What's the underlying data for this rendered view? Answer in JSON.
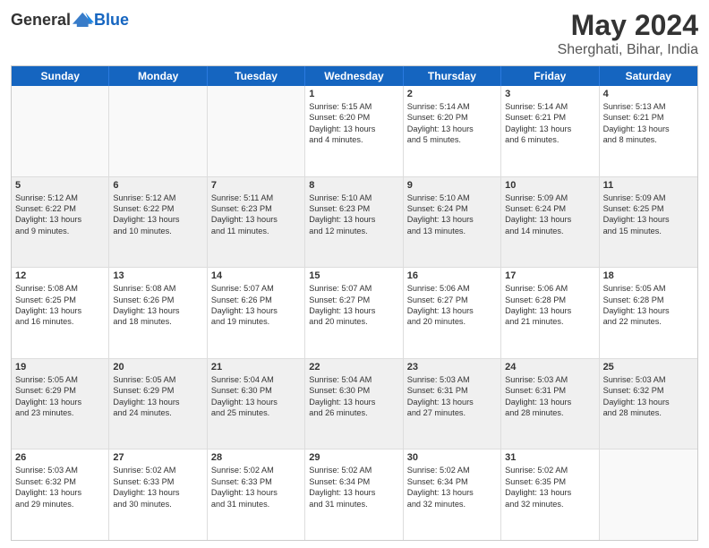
{
  "header": {
    "logo_general": "General",
    "logo_blue": "Blue",
    "title": "May 2024",
    "location": "Sherghati, Bihar, India"
  },
  "days_of_week": [
    "Sunday",
    "Monday",
    "Tuesday",
    "Wednesday",
    "Thursday",
    "Friday",
    "Saturday"
  ],
  "weeks": [
    [
      {
        "day": "",
        "info": [],
        "empty": true
      },
      {
        "day": "",
        "info": [],
        "empty": true
      },
      {
        "day": "",
        "info": [],
        "empty": true
      },
      {
        "day": "1",
        "info": [
          "Sunrise: 5:15 AM",
          "Sunset: 6:20 PM",
          "Daylight: 13 hours",
          "and 4 minutes."
        ]
      },
      {
        "day": "2",
        "info": [
          "Sunrise: 5:14 AM",
          "Sunset: 6:20 PM",
          "Daylight: 13 hours",
          "and 5 minutes."
        ]
      },
      {
        "day": "3",
        "info": [
          "Sunrise: 5:14 AM",
          "Sunset: 6:21 PM",
          "Daylight: 13 hours",
          "and 6 minutes."
        ]
      },
      {
        "day": "4",
        "info": [
          "Sunrise: 5:13 AM",
          "Sunset: 6:21 PM",
          "Daylight: 13 hours",
          "and 8 minutes."
        ]
      }
    ],
    [
      {
        "day": "5",
        "info": [
          "Sunrise: 5:12 AM",
          "Sunset: 6:22 PM",
          "Daylight: 13 hours",
          "and 9 minutes."
        ],
        "shaded": true
      },
      {
        "day": "6",
        "info": [
          "Sunrise: 5:12 AM",
          "Sunset: 6:22 PM",
          "Daylight: 13 hours",
          "and 10 minutes."
        ],
        "shaded": true
      },
      {
        "day": "7",
        "info": [
          "Sunrise: 5:11 AM",
          "Sunset: 6:23 PM",
          "Daylight: 13 hours",
          "and 11 minutes."
        ],
        "shaded": true
      },
      {
        "day": "8",
        "info": [
          "Sunrise: 5:10 AM",
          "Sunset: 6:23 PM",
          "Daylight: 13 hours",
          "and 12 minutes."
        ],
        "shaded": true
      },
      {
        "day": "9",
        "info": [
          "Sunrise: 5:10 AM",
          "Sunset: 6:24 PM",
          "Daylight: 13 hours",
          "and 13 minutes."
        ],
        "shaded": true
      },
      {
        "day": "10",
        "info": [
          "Sunrise: 5:09 AM",
          "Sunset: 6:24 PM",
          "Daylight: 13 hours",
          "and 14 minutes."
        ],
        "shaded": true
      },
      {
        "day": "11",
        "info": [
          "Sunrise: 5:09 AM",
          "Sunset: 6:25 PM",
          "Daylight: 13 hours",
          "and 15 minutes."
        ],
        "shaded": true
      }
    ],
    [
      {
        "day": "12",
        "info": [
          "Sunrise: 5:08 AM",
          "Sunset: 6:25 PM",
          "Daylight: 13 hours",
          "and 16 minutes."
        ]
      },
      {
        "day": "13",
        "info": [
          "Sunrise: 5:08 AM",
          "Sunset: 6:26 PM",
          "Daylight: 13 hours",
          "and 18 minutes."
        ]
      },
      {
        "day": "14",
        "info": [
          "Sunrise: 5:07 AM",
          "Sunset: 6:26 PM",
          "Daylight: 13 hours",
          "and 19 minutes."
        ]
      },
      {
        "day": "15",
        "info": [
          "Sunrise: 5:07 AM",
          "Sunset: 6:27 PM",
          "Daylight: 13 hours",
          "and 20 minutes."
        ]
      },
      {
        "day": "16",
        "info": [
          "Sunrise: 5:06 AM",
          "Sunset: 6:27 PM",
          "Daylight: 13 hours",
          "and 20 minutes."
        ]
      },
      {
        "day": "17",
        "info": [
          "Sunrise: 5:06 AM",
          "Sunset: 6:28 PM",
          "Daylight: 13 hours",
          "and 21 minutes."
        ]
      },
      {
        "day": "18",
        "info": [
          "Sunrise: 5:05 AM",
          "Sunset: 6:28 PM",
          "Daylight: 13 hours",
          "and 22 minutes."
        ]
      }
    ],
    [
      {
        "day": "19",
        "info": [
          "Sunrise: 5:05 AM",
          "Sunset: 6:29 PM",
          "Daylight: 13 hours",
          "and 23 minutes."
        ],
        "shaded": true
      },
      {
        "day": "20",
        "info": [
          "Sunrise: 5:05 AM",
          "Sunset: 6:29 PM",
          "Daylight: 13 hours",
          "and 24 minutes."
        ],
        "shaded": true
      },
      {
        "day": "21",
        "info": [
          "Sunrise: 5:04 AM",
          "Sunset: 6:30 PM",
          "Daylight: 13 hours",
          "and 25 minutes."
        ],
        "shaded": true
      },
      {
        "day": "22",
        "info": [
          "Sunrise: 5:04 AM",
          "Sunset: 6:30 PM",
          "Daylight: 13 hours",
          "and 26 minutes."
        ],
        "shaded": true
      },
      {
        "day": "23",
        "info": [
          "Sunrise: 5:03 AM",
          "Sunset: 6:31 PM",
          "Daylight: 13 hours",
          "and 27 minutes."
        ],
        "shaded": true
      },
      {
        "day": "24",
        "info": [
          "Sunrise: 5:03 AM",
          "Sunset: 6:31 PM",
          "Daylight: 13 hours",
          "and 28 minutes."
        ],
        "shaded": true
      },
      {
        "day": "25",
        "info": [
          "Sunrise: 5:03 AM",
          "Sunset: 6:32 PM",
          "Daylight: 13 hours",
          "and 28 minutes."
        ],
        "shaded": true
      }
    ],
    [
      {
        "day": "26",
        "info": [
          "Sunrise: 5:03 AM",
          "Sunset: 6:32 PM",
          "Daylight: 13 hours",
          "and 29 minutes."
        ]
      },
      {
        "day": "27",
        "info": [
          "Sunrise: 5:02 AM",
          "Sunset: 6:33 PM",
          "Daylight: 13 hours",
          "and 30 minutes."
        ]
      },
      {
        "day": "28",
        "info": [
          "Sunrise: 5:02 AM",
          "Sunset: 6:33 PM",
          "Daylight: 13 hours",
          "and 31 minutes."
        ]
      },
      {
        "day": "29",
        "info": [
          "Sunrise: 5:02 AM",
          "Sunset: 6:34 PM",
          "Daylight: 13 hours",
          "and 31 minutes."
        ]
      },
      {
        "day": "30",
        "info": [
          "Sunrise: 5:02 AM",
          "Sunset: 6:34 PM",
          "Daylight: 13 hours",
          "and 32 minutes."
        ]
      },
      {
        "day": "31",
        "info": [
          "Sunrise: 5:02 AM",
          "Sunset: 6:35 PM",
          "Daylight: 13 hours",
          "and 32 minutes."
        ]
      },
      {
        "day": "",
        "info": [],
        "empty": true
      }
    ]
  ]
}
